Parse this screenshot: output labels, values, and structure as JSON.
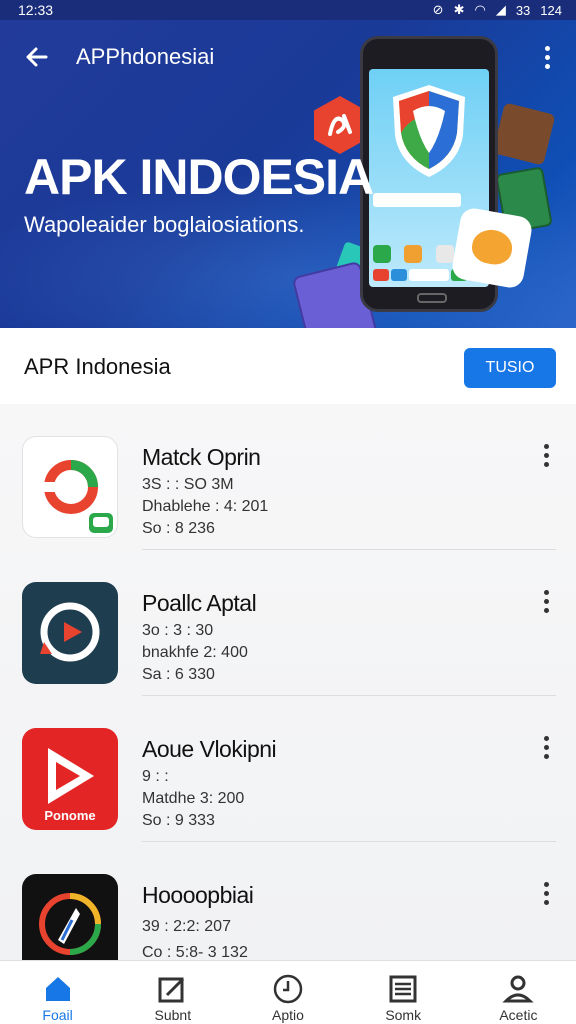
{
  "status_bar": {
    "time": "12:33",
    "indicators": "33",
    "battery": "124"
  },
  "app_bar": {
    "title": "APPhdonesiai",
    "back_icon": "arrow-left-icon",
    "menu_icon": "more-vert-icon"
  },
  "hero": {
    "headline": "APK INDOESIA",
    "subtitle": "Wapoleaider boglaiosiations."
  },
  "section": {
    "title": "APR Indonesia",
    "button_label": "TUSIO"
  },
  "apps": [
    {
      "name": "Matck Oprin",
      "line1": "3S  :  :  SO 3M",
      "line2": "Dhablehe  :  4: 201",
      "line3": "So  :  8 236"
    },
    {
      "name": "Poallc Aptal",
      "line1": "3o  :  3 : 30",
      "line2": "bnakhfe  2:  400",
      "line3": "Sa  :  6 330"
    },
    {
      "name": "Aoue Vlokipni",
      "line1": "9  :  :",
      "line2": "Matdhe  3:  200",
      "line3": "So  :  9 333"
    },
    {
      "name": "Hoooopbiai",
      "line1": "39  :  2:2:  207",
      "line2": "Co  :  5:8- 3  132",
      "line3": ""
    }
  ],
  "bottom_nav": [
    {
      "label": "Foail",
      "icon": "home-icon",
      "active": true
    },
    {
      "label": "Subnt",
      "icon": "edit-square-icon",
      "active": false
    },
    {
      "label": "Aptio",
      "icon": "clock-icon",
      "active": false
    },
    {
      "label": "Somk",
      "icon": "list-icon",
      "active": false
    },
    {
      "label": "Acetic",
      "icon": "person-icon",
      "active": false
    }
  ],
  "colors": {
    "accent": "#1877e6",
    "hero_bg": "#1a3a98"
  }
}
